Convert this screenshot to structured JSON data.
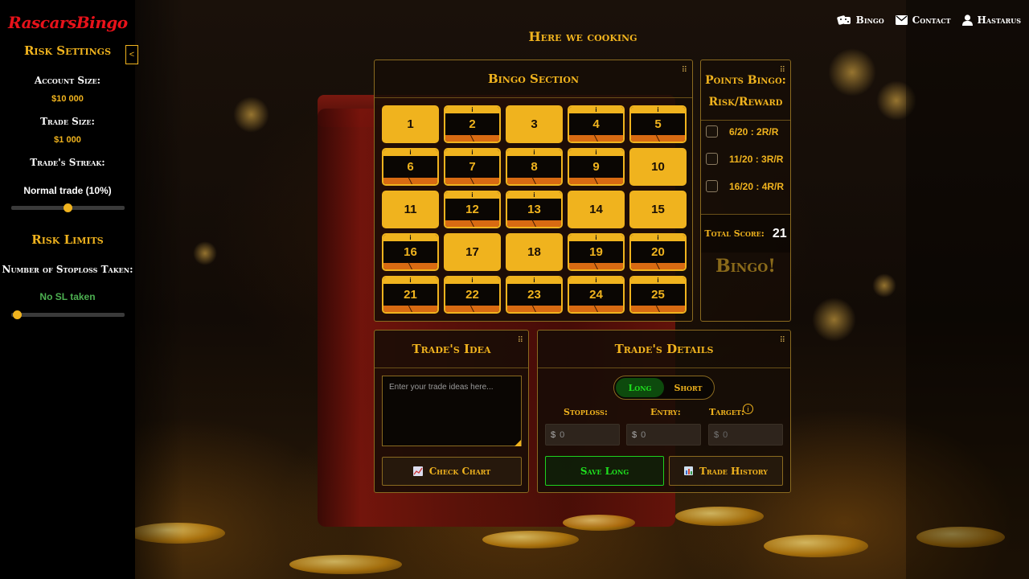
{
  "brand": "RascarsBingo",
  "nav": {
    "items": [
      {
        "label": "Bingo",
        "icon": "dice-icon"
      },
      {
        "label": "Contact",
        "icon": "envelope-icon"
      },
      {
        "label": "Hastarus",
        "icon": "user-icon"
      }
    ]
  },
  "sidebar": {
    "collapse_label": "<",
    "risk_settings_title": "Risk Settings",
    "account_size_label": "Account Size:",
    "account_size_value": "$10 000",
    "trade_size_label": "Trade Size:",
    "trade_size_value": "$1 000",
    "trade_streak_label": "Trade's Streak:",
    "trade_streak_value": "Normal trade (10%)",
    "streak_slider_level": 0.5,
    "risk_limits_title": "Risk Limits",
    "stoploss_label": "Number of Stoploss Taken:",
    "stoploss_value": "No SL taken",
    "stoploss_slider_level": 0,
    "stoploss_value_color": "#4caf50"
  },
  "page_title": "Here we cooking",
  "bingo": {
    "title": "Bingo Section",
    "cells": [
      {
        "n": "1",
        "state": "filled"
      },
      {
        "n": "2",
        "state": "empty"
      },
      {
        "n": "3",
        "state": "filled"
      },
      {
        "n": "4",
        "state": "empty"
      },
      {
        "n": "5",
        "state": "empty"
      },
      {
        "n": "6",
        "state": "empty"
      },
      {
        "n": "7",
        "state": "empty"
      },
      {
        "n": "8",
        "state": "empty"
      },
      {
        "n": "9",
        "state": "empty"
      },
      {
        "n": "10",
        "state": "filled"
      },
      {
        "n": "11",
        "state": "filled"
      },
      {
        "n": "12",
        "state": "empty"
      },
      {
        "n": "13",
        "state": "empty"
      },
      {
        "n": "14",
        "state": "filled"
      },
      {
        "n": "15",
        "state": "filled"
      },
      {
        "n": "16",
        "state": "empty"
      },
      {
        "n": "17",
        "state": "filled"
      },
      {
        "n": "18",
        "state": "filled"
      },
      {
        "n": "19",
        "state": "empty"
      },
      {
        "n": "20",
        "state": "empty"
      },
      {
        "n": "21",
        "state": "empty"
      },
      {
        "n": "22",
        "state": "empty"
      },
      {
        "n": "23",
        "state": "empty"
      },
      {
        "n": "24",
        "state": "empty"
      },
      {
        "n": "25",
        "state": "empty"
      }
    ]
  },
  "points": {
    "title_line1": "Points Bingo:",
    "title_line2": "Risk/Reward",
    "options": [
      "6/20 : 2R/R",
      "11/20 : 3R/R",
      "16/20 : 4R/R"
    ],
    "total_label": "Total Score:",
    "total_value": "21",
    "bingo_label": "Bingo!"
  },
  "idea": {
    "title": "Trade's Idea",
    "placeholder": "Enter your trade ideas here...",
    "check_chart_label": "Check Chart"
  },
  "details": {
    "title": "Trade's Details",
    "long_label": "Long",
    "short_label": "Short",
    "stoploss_label": "Stoploss:",
    "entry_label": "Entry:",
    "target_label": "Target:",
    "currency": "$",
    "stoploss_placeholder": "0",
    "entry_placeholder": "0",
    "target_placeholder": "0",
    "save_label": "Save Long",
    "history_label": "Trade History"
  }
}
